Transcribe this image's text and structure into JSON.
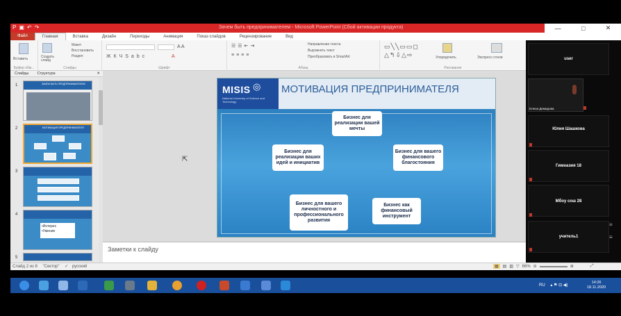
{
  "window": {
    "title": "Зачем быть предпринимателем - Microsoft PowerPoint (Сбой активации продукта)",
    "controls": [
      "—",
      "□",
      "✕"
    ]
  },
  "ribbon_tabs": [
    "Файл",
    "Главная",
    "Вставка",
    "Дизайн",
    "Переходы",
    "Анимация",
    "Показ слайдов",
    "Рецензирование",
    "Вид"
  ],
  "ribbon": {
    "clipboard": {
      "paste": "Вставить",
      "label": "Буфер обм..."
    },
    "slides": {
      "new_slide": "Создать слайд",
      "layout": "Макет",
      "reset": "Восстановить",
      "section": "Раздел",
      "label": "Слайды"
    },
    "font": {
      "label": "Шрифт"
    },
    "paragraph": {
      "text_direction": "Направление текста",
      "align_text": "Выровнять текст",
      "smartart": "Преобразовать в SmartArt",
      "label": "Абзац"
    },
    "drawing": {
      "arrange": "Упорядочить",
      "quick_styles": "Экспресс-стили",
      "label": "Рисование"
    }
  },
  "left_panel": {
    "tabs": [
      "Слайды",
      "Структура"
    ],
    "thumbnails": [
      {
        "num": "1",
        "title": "ЗАЧЕМ БЫТЬ ПРЕДПРИНИМАТЕЛЕМ"
      },
      {
        "num": "2",
        "title": "МОТИВАЦИЯ ПРЕДПРИНИМАТЕЛЯ"
      },
      {
        "num": "3",
        "title": ""
      },
      {
        "num": "4",
        "title": "",
        "bullets": [
          "Интерес",
          "Умение"
        ]
      },
      {
        "num": "5",
        "title": ""
      }
    ]
  },
  "slide": {
    "brand": "MISIS",
    "brand_sub": "National University of Science and Technology",
    "title": "МОТИВАЦИЯ ПРЕДПРИНИМАТЕЛЯ",
    "boxes": [
      "Бизнес для реализации вашей мечты",
      "Бизнес для реализации ваших идей и инициатив",
      "Бизнес для вашего финансового благостояния",
      "Бизнес для вашего личностного и профессионального развития",
      "Бизнес как финансовый инструмент"
    ]
  },
  "notes_placeholder": "Заметки к слайду",
  "status": {
    "slide_info": "Слайд 2 из 8",
    "theme": "\"Сектор\"",
    "language": "русский",
    "zoom": "66%"
  },
  "taskbar": {
    "lang": "RU",
    "time": "14:26",
    "date": "18.11.2020"
  },
  "video_call": {
    "participants": [
      {
        "name": "user"
      },
      {
        "name": "Елена Демидова"
      },
      {
        "name": "Юлия Шашкова"
      },
      {
        "name": "Гимназия 18"
      },
      {
        "name": "Мбоу сош 28"
      },
      {
        "name": "учитель1"
      }
    ]
  },
  "colors": {
    "titlebar": "#d82626",
    "slide_blue": "#1f6fb2",
    "taskbar": "#1a4f9c",
    "selection": "#f0a830"
  }
}
